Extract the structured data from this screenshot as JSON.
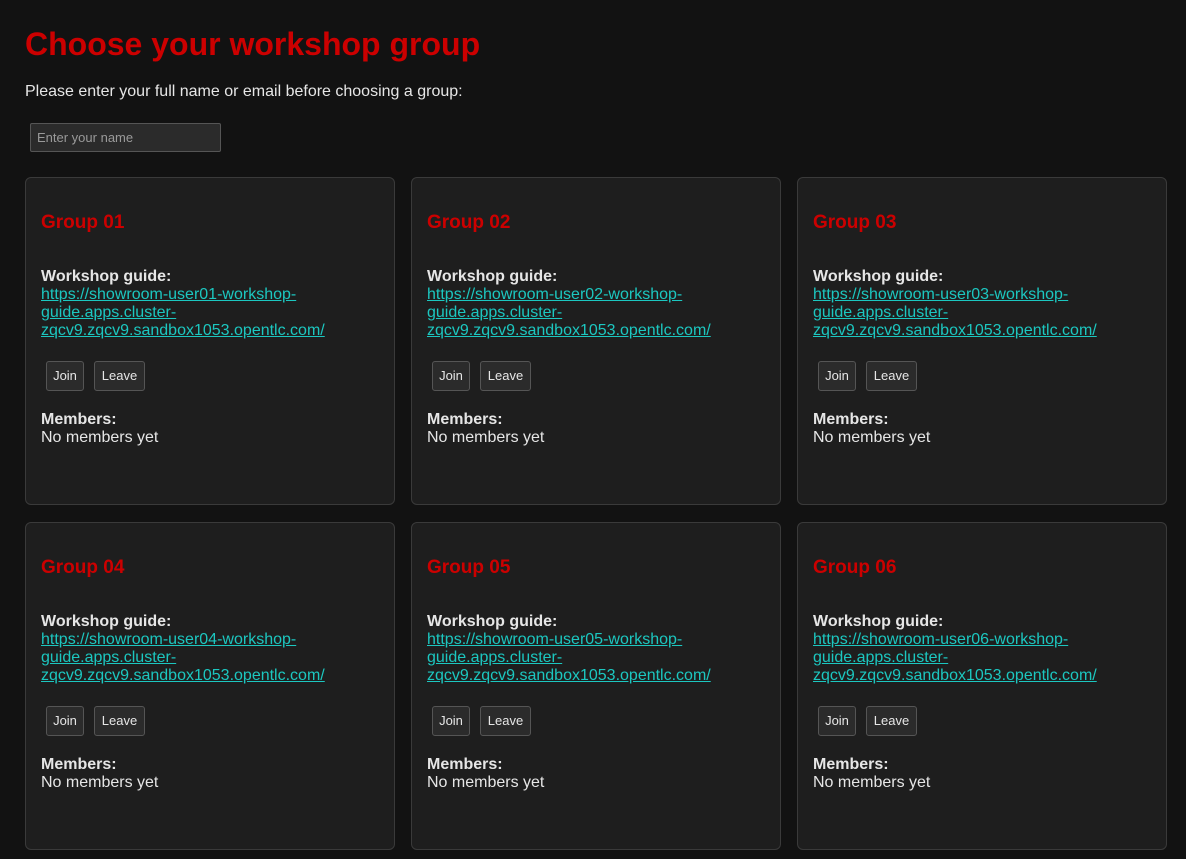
{
  "page": {
    "title": "Choose your workshop group",
    "prompt": "Please enter your full name or email before choosing a group:",
    "name_placeholder": "Enter your name",
    "name_value": ""
  },
  "colors": {
    "background": "#121212",
    "card_background": "#1e1e1e",
    "accent_red": "#cc0000",
    "link": "#1cc7c0",
    "text": "#e6e6e6"
  },
  "groups": [
    {
      "name": "Group 01",
      "guide_label": "Workshop guide:",
      "guide_url": "https://showroom-user01-workshop-guide.apps.cluster-zqcv9.zqcv9.sandbox1053.opentlc.com/",
      "join_label": "Join",
      "leave_label": "Leave",
      "members_label": "Members:",
      "members_text": "No members yet"
    },
    {
      "name": "Group 02",
      "guide_label": "Workshop guide:",
      "guide_url": "https://showroom-user02-workshop-guide.apps.cluster-zqcv9.zqcv9.sandbox1053.opentlc.com/",
      "join_label": "Join",
      "leave_label": "Leave",
      "members_label": "Members:",
      "members_text": "No members yet"
    },
    {
      "name": "Group 03",
      "guide_label": "Workshop guide:",
      "guide_url": "https://showroom-user03-workshop-guide.apps.cluster-zqcv9.zqcv9.sandbox1053.opentlc.com/",
      "join_label": "Join",
      "leave_label": "Leave",
      "members_label": "Members:",
      "members_text": "No members yet"
    },
    {
      "name": "Group 04",
      "guide_label": "Workshop guide:",
      "guide_url": "https://showroom-user04-workshop-guide.apps.cluster-zqcv9.zqcv9.sandbox1053.opentlc.com/",
      "join_label": "Join",
      "leave_label": "Leave",
      "members_label": "Members:",
      "members_text": "No members yet"
    },
    {
      "name": "Group 05",
      "guide_label": "Workshop guide:",
      "guide_url": "https://showroom-user05-workshop-guide.apps.cluster-zqcv9.zqcv9.sandbox1053.opentlc.com/",
      "join_label": "Join",
      "leave_label": "Leave",
      "members_label": "Members:",
      "members_text": "No members yet"
    },
    {
      "name": "Group 06",
      "guide_label": "Workshop guide:",
      "guide_url": "https://showroom-user06-workshop-guide.apps.cluster-zqcv9.zqcv9.sandbox1053.opentlc.com/",
      "join_label": "Join",
      "leave_label": "Leave",
      "members_label": "Members:",
      "members_text": "No members yet"
    }
  ]
}
